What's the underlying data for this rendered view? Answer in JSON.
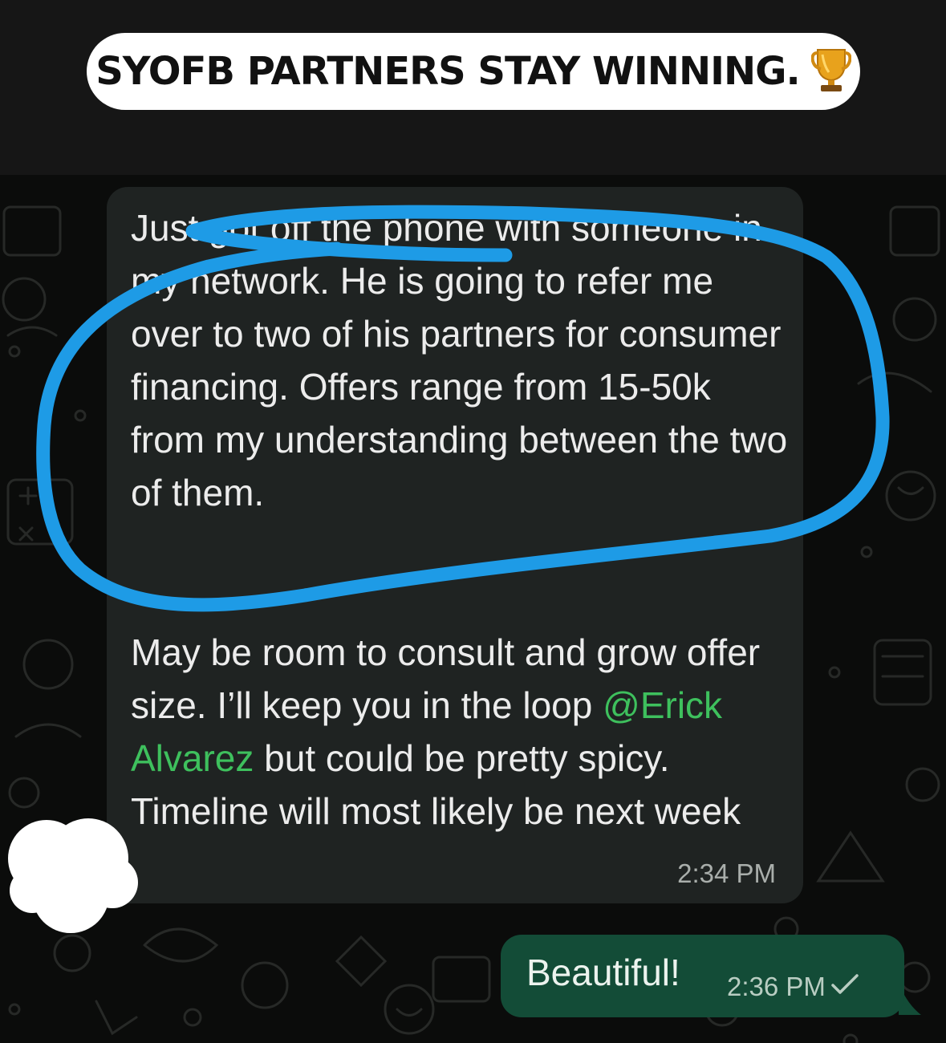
{
  "caption": {
    "text": "SYOFB PARTNERS STAY WINNING.",
    "icon": "trophy-icon"
  },
  "incoming_message": {
    "paragraph1": "Just got off the phone with someone in my network. He is going to refer me over to two of his partners for consumer financing. Offers range from 15-50k from my understanding between the two of them.",
    "paragraph2_before": "May be room to consult and grow offer size. I’ll keep you in the loop ",
    "mention": "@Erick Alvarez",
    "paragraph2_after": " but could be pretty spicy. Timeline will most likely be next week",
    "time": "2:34 PM"
  },
  "outgoing_message": {
    "text": "Beautiful!",
    "time": "2:36 PM",
    "status_icon": "single-check-icon"
  },
  "colors": {
    "incoming_bubble": "#1f2322",
    "outgoing_bubble": "#134c37",
    "mention": "#3ec05d",
    "annotation": "#1e9be6"
  }
}
